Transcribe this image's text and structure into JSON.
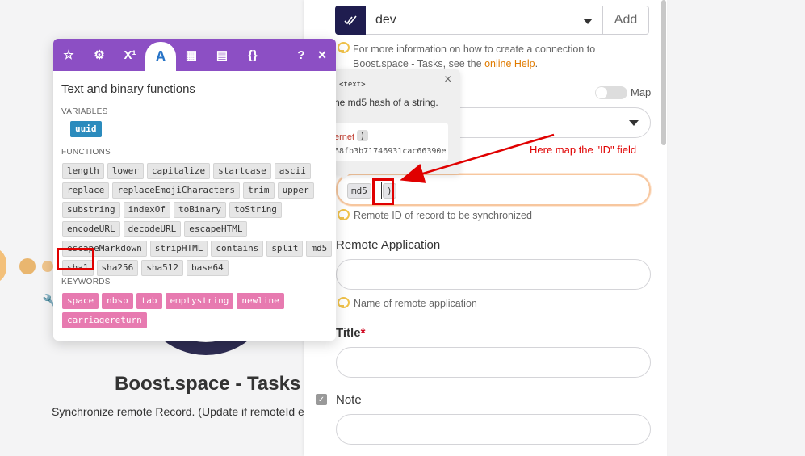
{
  "module": {
    "title": "Boost.space - Tasks",
    "subtitle": "Synchronize remote Record. (Update if remoteId exists,"
  },
  "panel": {
    "connection": {
      "value": "dev",
      "add_label": "Add"
    },
    "connection_hint_prefix": "For more information on how to create a connection to Boost.space - Tasks, see the ",
    "connection_hint_link": "online Help",
    "connection_hint_suffix": ".",
    "map_label": "Map",
    "remote_id": {
      "token_fn": "md5",
      "token_close": ")",
      "hint": "Remote ID of record to be synchronized"
    },
    "remote_application": {
      "label": "Remote Application",
      "hint": "Name of remote application"
    },
    "title_field": {
      "label": "Title",
      "required_mark": "*"
    },
    "note_field": {
      "label": "Note"
    }
  },
  "annotation": {
    "text": "Here map the \"ID\" field",
    "color": "#e00000"
  },
  "tooltip": {
    "type": "<text>",
    "description": "he md5 hash of a string.",
    "example_fn": "ernet",
    "example_paren": ")",
    "example_result": "68fb3b71746931cac66390e"
  },
  "picker": {
    "tabs": [
      {
        "icon": "star-icon",
        "glyph": "☆"
      },
      {
        "icon": "gear-icon",
        "glyph": "⚙"
      },
      {
        "icon": "math-icon",
        "glyph": "X¹"
      },
      {
        "icon": "text-icon",
        "glyph": "A"
      },
      {
        "icon": "calendar-icon",
        "glyph": "▦"
      },
      {
        "icon": "table-icon",
        "glyph": "▤"
      },
      {
        "icon": "braces-icon",
        "glyph": "{}"
      }
    ],
    "help_glyph": "?",
    "close_glyph": "×",
    "title": "Text and binary functions",
    "variables_title": "VARIABLES",
    "variables": [
      "uuid"
    ],
    "functions_title": "FUNCTIONS",
    "functions": [
      "length",
      "lower",
      "capitalize",
      "startcase",
      "ascii",
      "replace",
      "replaceEmojiCharacters",
      "trim",
      "upper",
      "substring",
      "indexOf",
      "toBinary",
      "toString",
      "encodeURL",
      "decodeURL",
      "escapeHTML",
      "escapeMarkdown",
      "stripHTML",
      "contains",
      "split",
      "md5",
      "sha1",
      "sha256",
      "sha512",
      "base64"
    ],
    "keywords_title": "KEYWORDS",
    "keywords": [
      "space",
      "nbsp",
      "tab",
      "emptystring",
      "newline",
      "carriagereturn"
    ]
  },
  "colors": {
    "picker_header": "#8c4fc4",
    "variable_chip": "#2b8bbd",
    "keyword_chip": "#e77ab0",
    "connection_icon": "#1f1d4f",
    "highlight_box": "#e00000"
  }
}
